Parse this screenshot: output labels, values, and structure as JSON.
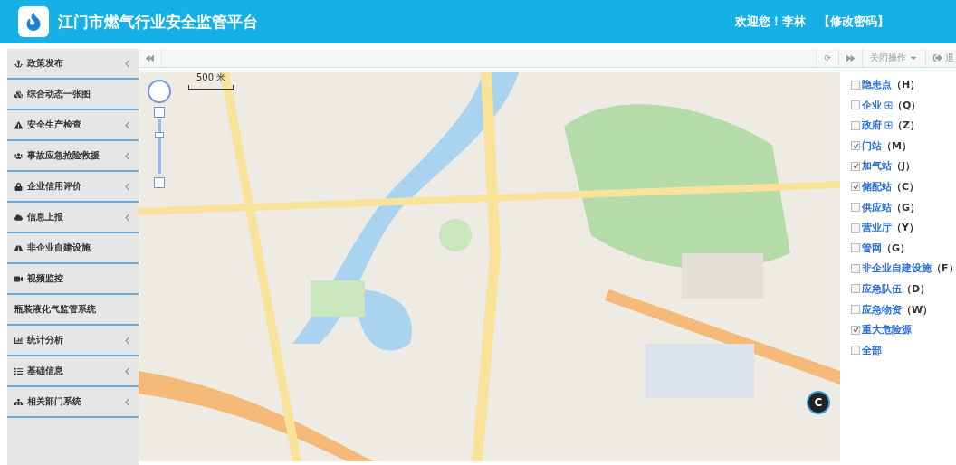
{
  "header": {
    "title": "江门市燃气行业安全监管平台",
    "welcome": "欢迎您！李林",
    "change_password": "【修改密码】"
  },
  "sidebar": {
    "items": [
      {
        "label": "政策发布",
        "has_children": true
      },
      {
        "label": "综合动态一张图",
        "has_children": false
      },
      {
        "label": "安全生产检查",
        "has_children": true
      },
      {
        "label": "事故应急抢险救援",
        "has_children": true
      },
      {
        "label": "企业信用评价",
        "has_children": true
      },
      {
        "label": "信息上报",
        "has_children": true
      },
      {
        "label": "非企业自建设施",
        "has_children": false
      },
      {
        "label": "视频监控",
        "has_children": false
      },
      {
        "label": "瓶装液化气监管系统",
        "has_children": false
      },
      {
        "label": "统计分析",
        "has_children": true
      },
      {
        "label": "基础信息",
        "has_children": true
      },
      {
        "label": "相关部门系统",
        "has_children": true
      }
    ]
  },
  "toolbar": {
    "refresh": "⟳",
    "close_ops": "关闭操作",
    "exit": "退"
  },
  "map": {
    "scale": "500 米",
    "marker": "C",
    "zoom": {
      "level": 0.75
    }
  },
  "legend": [
    {
      "label": "隐患点",
      "key": "（H）",
      "checked": false,
      "expandable": false
    },
    {
      "label": "企业",
      "key": "（Q）",
      "checked": false,
      "expandable": true
    },
    {
      "label": "政府",
      "key": "（Z）",
      "checked": false,
      "expandable": true
    },
    {
      "label": "门站",
      "key": "（M）",
      "checked": true,
      "expandable": false
    },
    {
      "label": "加气站",
      "key": "（J）",
      "checked": true,
      "expandable": false
    },
    {
      "label": "储配站",
      "key": "（C）",
      "checked": true,
      "expandable": false
    },
    {
      "label": "供应站",
      "key": "（G）",
      "checked": false,
      "expandable": false
    },
    {
      "label": "营业厅",
      "key": "（Y）",
      "checked": false,
      "expandable": false
    },
    {
      "label": "管网",
      "key": "（G）",
      "checked": false,
      "expandable": false
    },
    {
      "label": "非企业自建设施",
      "key": "（F）",
      "checked": false,
      "expandable": false
    },
    {
      "label": "应急队伍",
      "key": "（D）",
      "checked": false,
      "expandable": false
    },
    {
      "label": "应急物资",
      "key": "（W）",
      "checked": false,
      "expandable": false
    },
    {
      "label": "重大危险源",
      "checked": true,
      "expandable": false
    },
    {
      "label": "全部",
      "checked": false,
      "expandable": false
    }
  ]
}
